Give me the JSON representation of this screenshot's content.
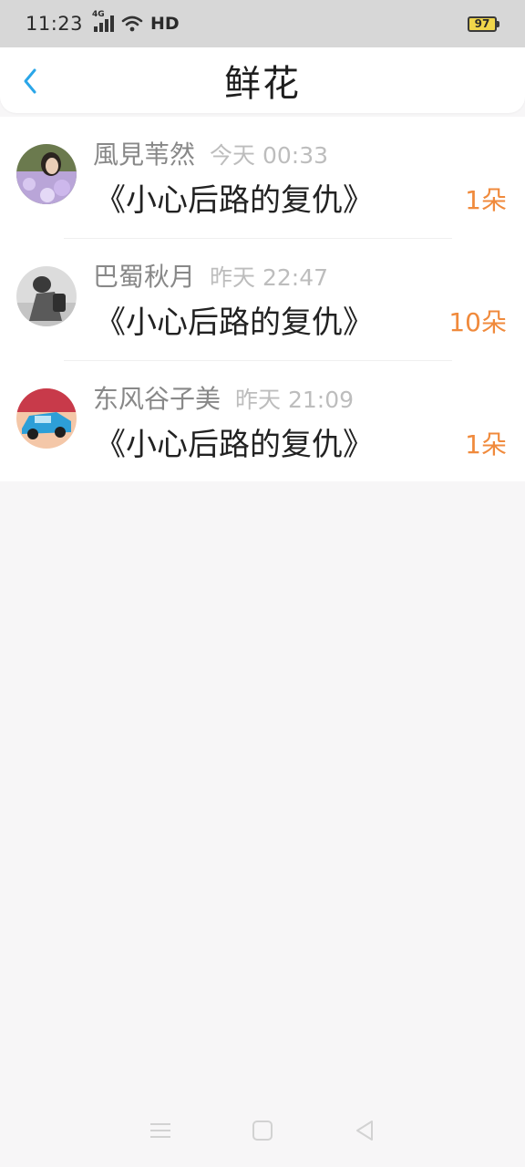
{
  "status": {
    "time": "11:23",
    "network": "4G",
    "hd": "HD",
    "battery": "97"
  },
  "header": {
    "title": "鲜花"
  },
  "items": [
    {
      "user": "風見苇然",
      "time": "今天 00:33",
      "book": "《小心后路的复仇》",
      "count": "1朵"
    },
    {
      "user": "巴蜀秋月",
      "time": "昨天 22:47",
      "book": "《小心后路的复仇》",
      "count": "10朵"
    },
    {
      "user": "东风谷子美",
      "time": "昨天 21:09",
      "book": "《小心后路的复仇》",
      "count": "1朵"
    }
  ],
  "colors": {
    "accent": "#2aa6e8",
    "count": "#f08a3c",
    "statusbar": "#d7d7d7",
    "background": "#f7f6f7"
  }
}
